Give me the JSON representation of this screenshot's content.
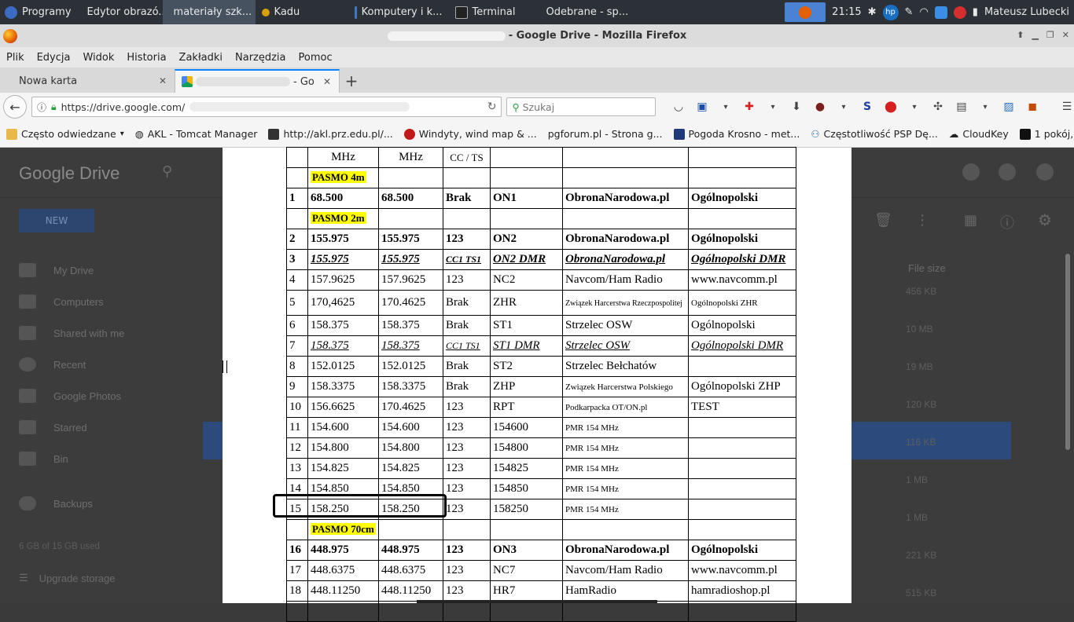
{
  "taskbar": {
    "start_label": "Programy",
    "items": [
      {
        "label": "Edytor obrazó..."
      },
      {
        "label": "materiały szk..."
      },
      {
        "label": "Kadu"
      },
      {
        "label": "Komputery i k..."
      },
      {
        "label": "Terminal"
      },
      {
        "label": "Odebrane - sp..."
      }
    ],
    "clock": "21:15",
    "user": "Mateusz Lubecki"
  },
  "window": {
    "title": "- Google Drive - Mozilla Firefox"
  },
  "menu": [
    "Plik",
    "Edycja",
    "Widok",
    "Historia",
    "Zakładki",
    "Narzędzia",
    "Pomoc"
  ],
  "tabs": {
    "tab1": "Nowa karta",
    "tab2": "- Go"
  },
  "nav": {
    "url": "https://drive.google.com/",
    "search_placeholder": "Szukaj"
  },
  "bookmarks": [
    "Często odwiedzane",
    "AKL - Tomcat Manager",
    "http://akl.prz.edu.pl/...",
    "Windyty, wind map & ...",
    "pgforum.pl - Strona g...",
    "Pogoda Krosno - met...",
    "Częstotliwość PSP Dę...",
    "CloudKey",
    "1 pokój, mieszkanie n..."
  ],
  "drive": {
    "logo": "Google Drive",
    "new_button": "NEW",
    "sidebar": [
      "My Drive",
      "Computers",
      "Shared with me",
      "Recent",
      "Google Photos",
      "Starred",
      "Bin"
    ],
    "backups": "Backups",
    "storage": "6 GB of 15 GB used",
    "upgrade": "Upgrade storage",
    "file_size_header": "File size",
    "file_sizes": [
      "456 KB",
      "10 MB",
      "19 MB",
      "120 KB",
      "116 KB",
      "1 MB",
      "1 MB",
      "221 KB",
      "515 KB"
    ]
  },
  "table": {
    "header": [
      "",
      "MHz",
      "MHz",
      "CC / TS",
      "",
      "",
      ""
    ],
    "band_4m": "PASMO 4m",
    "band_2m": "PASMO 2m",
    "band_70cm": "PASMO 70cm",
    "rows_4m": [
      [
        "1",
        "68.500",
        "68.500",
        "Brak",
        "ON1",
        "ObronaNarodowa.pl",
        "Ogólnopolski"
      ]
    ],
    "rows_2m": [
      [
        "2",
        "155.975",
        "155.975",
        "123",
        "ON2",
        "ObronaNarodowa.pl",
        " Ogólnopolski"
      ],
      [
        "3",
        "155.975",
        "155.975",
        "CC1 TS1",
        "ON2 DMR",
        "ObronaNarodowa.pl",
        "Ogólnopolski DMR"
      ],
      [
        "4",
        "157.9625",
        "157.9625",
        "123",
        "NC2",
        "Navcom/Ham Radio",
        "www.navcomm.pl"
      ],
      [
        "5",
        "170,4625",
        "170.4625",
        "Brak",
        "ZHR",
        "Związek Harcerstwa Rzeczpospolitej",
        "Ogólnopolski ZHR"
      ],
      [
        "6",
        "158.375",
        "158.375",
        "Brak",
        "ST1",
        "Strzelec OSW",
        "Ogólnopolski"
      ],
      [
        "7",
        "158.375",
        "158.375",
        "CC1 TS1",
        "ST1 DMR",
        "Strzelec OSW",
        "Ogólnopolski DMR"
      ],
      [
        "8",
        "152.0125",
        "152.0125",
        "Brak",
        "ST2",
        "Strzelec Bełchatów",
        ""
      ],
      [
        "9",
        "158.3375",
        "158.3375",
        "Brak",
        "ZHP",
        "Związek Harcerstwa Polskiego",
        "Ogólnopolski ZHP"
      ],
      [
        "10",
        "156.6625",
        "170.4625",
        "123",
        "RPT",
        "Podkarpacka OT/ON.pl",
        "TEST"
      ],
      [
        "11",
        "154.600",
        "154.600",
        "123",
        "154600",
        "PMR 154 MHz",
        ""
      ],
      [
        "12",
        "154.800",
        "154.800",
        "123",
        "154800",
        "PMR 154 MHz",
        ""
      ],
      [
        "13",
        "154.825",
        "154.825",
        "123",
        "154825",
        "PMR 154 MHz",
        ""
      ],
      [
        "14",
        "154.850",
        "154.850",
        "123",
        "154850",
        "PMR 154 MHz",
        ""
      ],
      [
        "15",
        "158.250",
        "158.250",
        "123",
        "158250",
        "PMR 154 MHz",
        ""
      ]
    ],
    "rows_70cm": [
      [
        "16",
        "448.975",
        "448.975",
        "123",
        "ON3",
        "ObronaNarodowa.pl",
        "Ogólnopolski"
      ],
      [
        "17",
        "448.6375",
        "448.6375",
        "123",
        "NC7",
        "Navcom/Ham Radio",
        "www.navcomm.pl"
      ],
      [
        "18",
        "448.11250",
        "448.11250",
        "123",
        "HR7",
        "HamRadio",
        "hamradioshop.pl"
      ]
    ]
  }
}
